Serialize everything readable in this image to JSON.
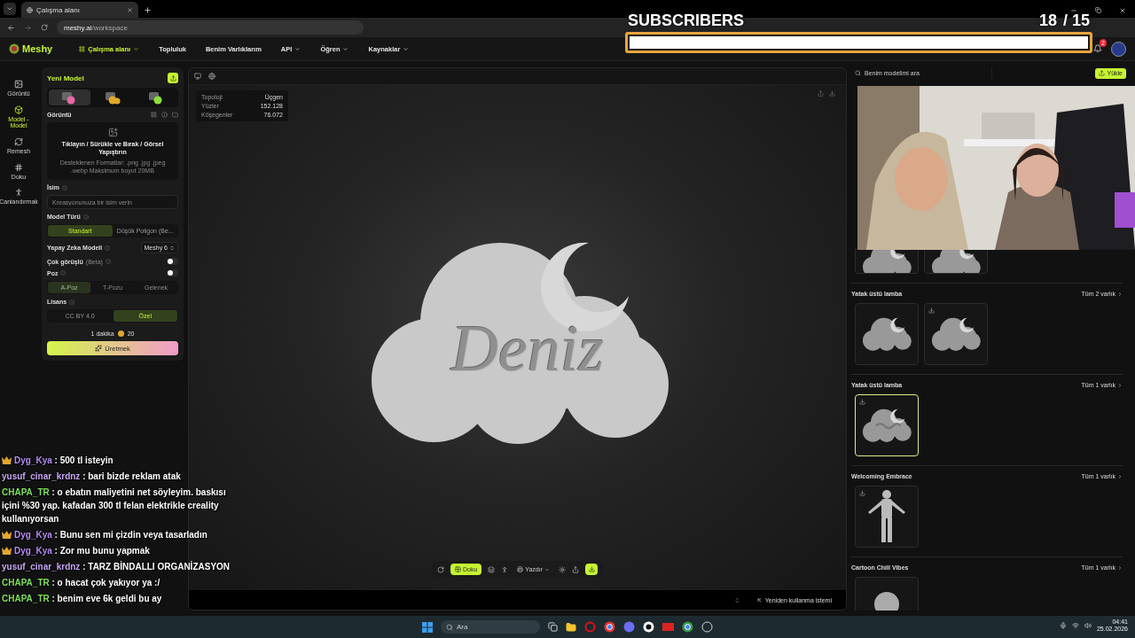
{
  "browser": {
    "tab_title": "Çalışma alanı",
    "url_host": "meshy.ai",
    "url_path": "/workspace"
  },
  "nav": {
    "logo": "Meshy",
    "items": [
      {
        "label": "Çalışma alanı",
        "selected": true,
        "dropdown": true
      },
      {
        "label": "Topluluk",
        "selected": false,
        "dropdown": false
      },
      {
        "label": "Benim Varlıklarım",
        "selected": false,
        "dropdown": false
      },
      {
        "label": "API",
        "selected": false,
        "dropdown": true
      },
      {
        "label": "Öğren",
        "selected": false,
        "dropdown": true
      },
      {
        "label": "Kaynaklar",
        "selected": false,
        "dropdown": true
      }
    ],
    "notification_count": "2"
  },
  "subscribers": {
    "label": "SUBSCRIBERS",
    "count": "18",
    "goal": "/ 15",
    "level": 1
  },
  "rail": [
    {
      "label": "Görüntü",
      "selected": false
    },
    {
      "label": "Model - Model",
      "selected": true
    },
    {
      "label": "Remesh",
      "selected": false
    },
    {
      "label": "Doku",
      "selected": false
    },
    {
      "label": "Canlandırmak",
      "selected": false
    }
  ],
  "panel": {
    "title": "Yeni Model",
    "mode_tabs": [
      {
        "selected": true
      },
      {
        "selected": false
      },
      {
        "selected": false
      }
    ],
    "image_label": "Görüntü",
    "upload_text": "Tıklayın / Sürükle ve Bırak / Görsel Yapıştırın",
    "upload_hint": "Desteklenen Formatlar: .png .jpg .jpeg .webp Maksimum boyut 20MB",
    "name_label": "İsim",
    "name_placeholder": "Kreasyonunuza bir isim verin",
    "model_type_label": "Model Türü",
    "model_types": [
      {
        "label": "Standart",
        "selected": true
      },
      {
        "label": "Düşük Poligon (Be...",
        "selected": false
      }
    ],
    "ai_model_label": "Yapay Zeka Modeli",
    "ai_model": "Meshy 6",
    "multiview_label": "Çok görüşlü",
    "multiview_tag": "(Beta)",
    "multiview_on": false,
    "pose_label": "Poz",
    "pose_on": false,
    "poses": [
      {
        "label": "A-Poz",
        "selected": true
      },
      {
        "label": "T-Pozu",
        "selected": false
      },
      {
        "label": "Gelenek",
        "selected": false
      }
    ],
    "license_label": "Lisans",
    "licenses": [
      {
        "label": "CC BY 4.0",
        "selected": false
      },
      {
        "label": "Özel",
        "selected": true
      }
    ],
    "time": "1 dakika",
    "credits": "20",
    "generate": "Üretmek"
  },
  "viewport": {
    "stats": [
      {
        "label": "Topoloji",
        "value": "Üçgen"
      },
      {
        "label": "Yüzler",
        "value": "152.128"
      },
      {
        "label": "Köşegenler",
        "value": "76.072"
      }
    ],
    "model_text": "Deniz",
    "texture_button": {
      "label": "Doku",
      "selected": true
    },
    "print_menu": "Yazdır",
    "reuse_prompt": "Yeniden kullanma istemi"
  },
  "assets": {
    "search_placeholder": "Benim modelimi ara",
    "upload": "Yükle",
    "groups": [
      {
        "items": [
          {
            "kind": "cloud",
            "selected": false,
            "has_download": false
          },
          {
            "kind": "cloud",
            "selected": false,
            "has_download": false
          }
        ]
      },
      {
        "title": "Yatak üstü lamba",
        "count": "Tüm 2 varlık",
        "items": [
          {
            "kind": "cloud",
            "selected": false,
            "has_download": false
          },
          {
            "kind": "cloud",
            "selected": false,
            "has_download": true
          }
        ]
      },
      {
        "title": "Yatak üstü lamba",
        "count": "Tüm 1 varlık",
        "items": [
          {
            "kind": "lettered_cloud",
            "selected": true,
            "has_download": true
          }
        ]
      },
      {
        "title": "Welcoming Embrace",
        "count": "Tüm 1 varlık",
        "items": [
          {
            "kind": "figure",
            "selected": false,
            "has_download": true
          }
        ]
      },
      {
        "title": "Cartoon Chill Vibes",
        "count": "Tüm 1 varlık",
        "items": [
          {
            "kind": "head",
            "selected": false,
            "has_download": false
          }
        ]
      }
    ]
  },
  "chat": [
    {
      "user": "Dyg_Kya",
      "color": "#b58cf2",
      "badge": true,
      "text": ": 500 tl isteyin"
    },
    {
      "user": "yusuf_cinar_krdnz",
      "color": "#c9a6f5",
      "badge": false,
      "text": ": bari bizde reklam atak"
    },
    {
      "user": "CHAPA_TR",
      "color": "#7ee05a",
      "badge": false,
      "text": ": o ebatın maliyetini net söyleyim. baskısı içini %30 yap. kafadan 300 tl felan elektrikle creality kullanıyorsan"
    },
    {
      "user": "Dyg_Kya",
      "color": "#b58cf2",
      "badge": true,
      "text": ": Bunu sen mi çizdin veya tasarladın"
    },
    {
      "user": "Dyg_Kya",
      "color": "#b58cf2",
      "badge": true,
      "text": ": Zor mu bunu yapmak"
    },
    {
      "user": "yusuf_cinar_krdnz",
      "color": "#c9a6f5",
      "badge": false,
      "text": ": TARZ BİNDALLI ORGANİZASYON"
    },
    {
      "user": "CHAPA_TR",
      "color": "#7ee05a",
      "badge": false,
      "text": ": o hacat çok yakıyor ya :/"
    },
    {
      "user": "CHAPA_TR",
      "color": "#7ee05a",
      "badge": false,
      "text": ": benim eve 6k geldi bu ay"
    }
  ],
  "taskbar": {
    "search": "Ara",
    "time": "04:41",
    "date": "25.02.2026"
  }
}
